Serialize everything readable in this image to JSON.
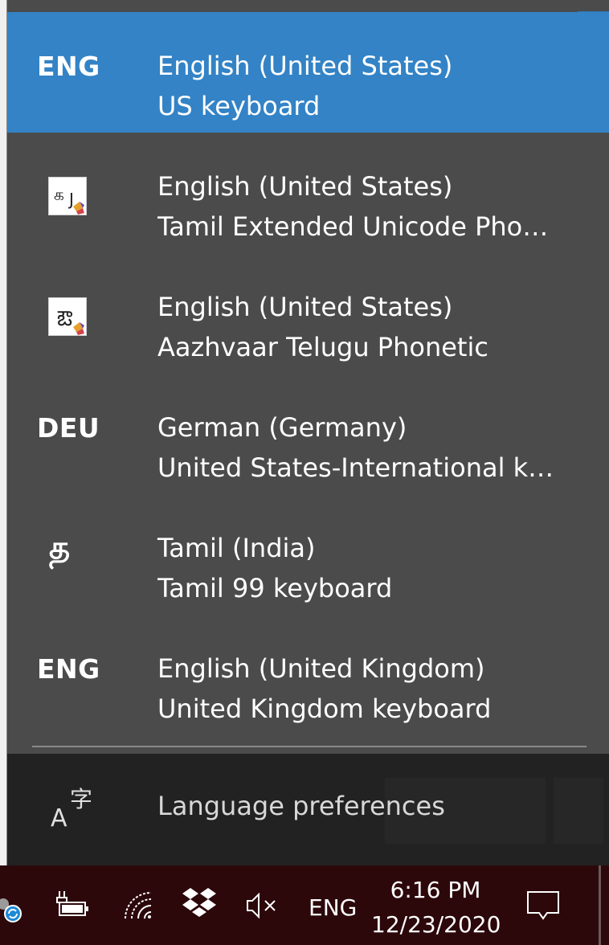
{
  "languages": [
    {
      "code": "ENG",
      "name": "English (United States)",
      "keyboard": "US keyboard",
      "selected": true
    },
    {
      "code": "",
      "icon": "ime-tamil-extended-icon",
      "name": "English (United States)",
      "keyboard": "Tamil Extended Unicode Pho…"
    },
    {
      "code": "",
      "icon": "ime-telugu-phonetic-icon",
      "name": "English (United States)",
      "keyboard": "Aazhvaar Telugu Phonetic"
    },
    {
      "code": "DEU",
      "name": "German (Germany)",
      "keyboard": "United States-International k…"
    },
    {
      "code": "த",
      "name": "Tamil (India)",
      "keyboard": "Tamil 99 keyboard"
    },
    {
      "code": "ENG",
      "name": "English (United Kingdom)",
      "keyboard": "United Kingdom keyboard"
    }
  ],
  "footer": {
    "preferences_label": "Language preferences",
    "icon": "language-icon"
  },
  "taskbar": {
    "tray_icons": [
      "sync-icon",
      "battery-icon",
      "wifi-icon",
      "dropbox-icon",
      "volume-muted-icon"
    ],
    "input_indicator": "ENG",
    "time": "6:16 PM",
    "date": "12/23/2020",
    "notification_icon": "action-center-icon"
  },
  "colors": {
    "selected": "#3383c6",
    "flyout_bg": "#4b4b4b",
    "footer_bg": "#222222",
    "taskbar_bg": "#2c080b"
  }
}
